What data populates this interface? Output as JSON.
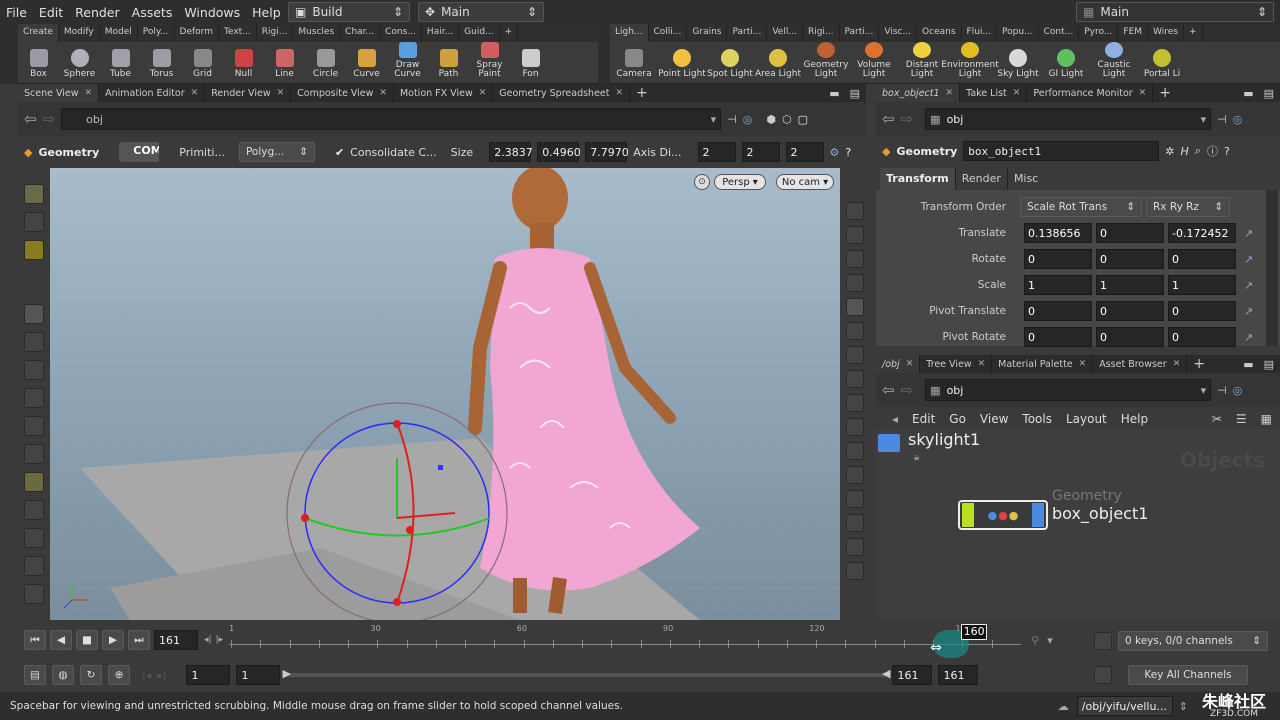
{
  "menu": [
    "File",
    "Edit",
    "Render",
    "Assets",
    "Windows",
    "Help"
  ],
  "desktops": {
    "build": "Build",
    "main_left": "Main",
    "main_right": "Main"
  },
  "shelf_left_tabs": [
    "Create",
    "Modify",
    "Model",
    "Poly...",
    "Deform",
    "Text...",
    "Rigi...",
    "Muscles",
    "Char...",
    "Cons...",
    "Hair...",
    "Guid..."
  ],
  "shelf_right_tabs": [
    "Ligh...",
    "Colli...",
    "Grains",
    "Parti...",
    "Vell...",
    "Rigi...",
    "Parti...",
    "Visc...",
    "Oceans",
    "Flui...",
    "Popu...",
    "Cont...",
    "Pyro...",
    "FEM",
    "Wires"
  ],
  "left_tools": [
    {
      "label": "Box",
      "icon": "box-icon",
      "color": "#9a9aa6"
    },
    {
      "label": "Sphere",
      "icon": "sphere-icon",
      "color": "#b0b0b8"
    },
    {
      "label": "Tube",
      "icon": "tube-icon",
      "color": "#a0a0a8"
    },
    {
      "label": "Torus",
      "icon": "torus-icon",
      "color": "#9c9ca4"
    },
    {
      "label": "Grid",
      "icon": "grid-icon",
      "color": "#888"
    },
    {
      "label": "Null",
      "icon": "null-icon",
      "color": "#c44"
    },
    {
      "label": "Line",
      "icon": "line-icon",
      "color": "#c66"
    },
    {
      "label": "Circle",
      "icon": "circle-icon",
      "color": "#999"
    },
    {
      "label": "Curve",
      "icon": "curve-icon",
      "color": "#d9a040"
    },
    {
      "label": "Draw Curve",
      "icon": "draw-curve-icon",
      "color": "#5aa0e0"
    },
    {
      "label": "Path",
      "icon": "path-icon",
      "color": "#d0a040"
    },
    {
      "label": "Spray Paint",
      "icon": "spray-paint-icon",
      "color": "#d06060"
    },
    {
      "label": "Fon",
      "icon": "font-icon",
      "color": "#ccc"
    }
  ],
  "right_tools": [
    {
      "label": "Camera",
      "icon": "camera-icon",
      "color": "#888"
    },
    {
      "label": "Point Light",
      "icon": "point-light-icon",
      "color": "#f0c040"
    },
    {
      "label": "Spot Light",
      "icon": "spot-light-icon",
      "color": "#e0d060"
    },
    {
      "label": "Area Light",
      "icon": "area-light-icon",
      "color": "#e0c040"
    },
    {
      "label": "Geometry Light",
      "icon": "geometry-light-icon",
      "color": "#c06030"
    },
    {
      "label": "Volume Light",
      "icon": "volume-light-icon",
      "color": "#e07030"
    },
    {
      "label": "Distant Light",
      "icon": "distant-light-icon",
      "color": "#f0d040"
    },
    {
      "label": "Environment Light",
      "icon": "environment-light-icon",
      "color": "#e0c020"
    },
    {
      "label": "Sky Light",
      "icon": "sky-light-icon",
      "color": "#d8d8d8"
    },
    {
      "label": "GI Light",
      "icon": "gi-light-icon",
      "color": "#60c060"
    },
    {
      "label": "Caustic Light",
      "icon": "caustic-light-icon",
      "color": "#90b0e0"
    },
    {
      "label": "Portal Li",
      "icon": "portal-light-icon",
      "color": "#c0c030"
    }
  ],
  "viewer_tabs": [
    "Scene View",
    "Animation Editor",
    "Render View",
    "Composite View",
    "Motion FX View",
    "Geometry Spreadsheet"
  ],
  "viewer": {
    "path": "obj",
    "context": "Geometry",
    "primitives": "Primiti...",
    "polygon_menu": "Polyg...",
    "consolidate": "Consolidate C...",
    "size_label": "Size",
    "size": [
      "2.3837",
      "0.4960",
      "7.7970"
    ],
    "axis_label": "Axis Di...",
    "axis": [
      "2",
      "2",
      "2"
    ],
    "persp": "Persp",
    "cam": "No cam",
    "watermark": "COM"
  },
  "param_tabs_top": [
    "box_object1",
    "Take List",
    "Performance Monitor"
  ],
  "params": {
    "path": "obj",
    "type": "Geometry",
    "node": "box_object1",
    "tabs": [
      "Transform",
      "Render",
      "Misc"
    ],
    "transform_order_label": "Transform Order",
    "transform_order": "Scale Rot Trans",
    "rot_order": "Rx Ry Rz",
    "rows": [
      {
        "label": "Translate",
        "values": [
          "0.138656",
          "0",
          "-0.172452"
        ]
      },
      {
        "label": "Rotate",
        "values": [
          "0",
          "0",
          "0"
        ]
      },
      {
        "label": "Scale",
        "values": [
          "1",
          "1",
          "1"
        ]
      },
      {
        "label": "Pivot Translate",
        "values": [
          "0",
          "0",
          "0"
        ]
      },
      {
        "label": "Pivot Rotate",
        "values": [
          "0",
          "0",
          "0"
        ]
      }
    ]
  },
  "network_tabs": [
    "/obj",
    "Tree View",
    "Material Palette",
    "Asset Browser"
  ],
  "network": {
    "path": "obj",
    "menu": [
      "Edit",
      "Go",
      "View",
      "Tools",
      "Layout",
      "Help"
    ],
    "context_label": "Objects",
    "nodes": [
      {
        "name": "skylight1",
        "type": ""
      },
      {
        "name": "box_object1",
        "type": "Geometry"
      }
    ]
  },
  "timeline": {
    "current_frame": "161",
    "marker_frame": "160",
    "ticks": [
      "1",
      "30",
      "60",
      "90",
      "120",
      "150"
    ],
    "range_start": "1",
    "range_start2": "1",
    "range_end": "161",
    "range_end2": "161",
    "keys": "0 keys, 0/0 channels",
    "key_all": "Key All Channels"
  },
  "status": {
    "message": "Spacebar for viewing and unrestricted scrubbing. Middle mouse drag on frame slider to hold scoped channel values.",
    "path": "/obj/yifu/vellu...",
    "watermark": "朱峰社区",
    "watermark_url": "ZF3D.COM"
  },
  "colors": {
    "accent": "#e87b24",
    "selected": "#f0c800",
    "dress": "#f2a6d4"
  }
}
